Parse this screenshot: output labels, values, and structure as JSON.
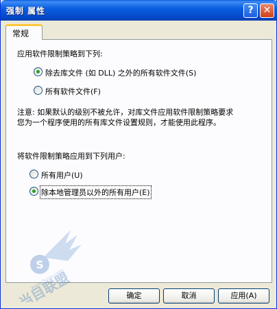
{
  "window": {
    "title": "强制 属性"
  },
  "titlebar_buttons": {
    "help_label": "?",
    "close_label": "✕"
  },
  "tabs": [
    {
      "label": "常规"
    }
  ],
  "section1": {
    "heading": "应用软件限制策略到下列:",
    "options": [
      {
        "label": "除去库文件 (如 DLL) 之外的所有软件文件(S)",
        "checked": true
      },
      {
        "label": "所有软件文件(F)",
        "checked": false
      }
    ]
  },
  "note": {
    "line1": "注意:  如果默认的级别不被允许，对库文件应用软件限制策略要求",
    "line2": "您为一个程序使用的所有库文件设置规则，才能使用此程序。"
  },
  "section2": {
    "heading": "将软件限制策略应用到下列用户:",
    "options": [
      {
        "label": "所有用户(U)",
        "checked": false
      },
      {
        "label": "除本地管理员以外的所有用户(E)",
        "checked": true
      }
    ]
  },
  "watermark": {
    "text": "当目联盟",
    "url": "www.5yun.com"
  },
  "buttons": {
    "ok": "确定",
    "cancel": "取消",
    "apply": "应用(A)"
  }
}
